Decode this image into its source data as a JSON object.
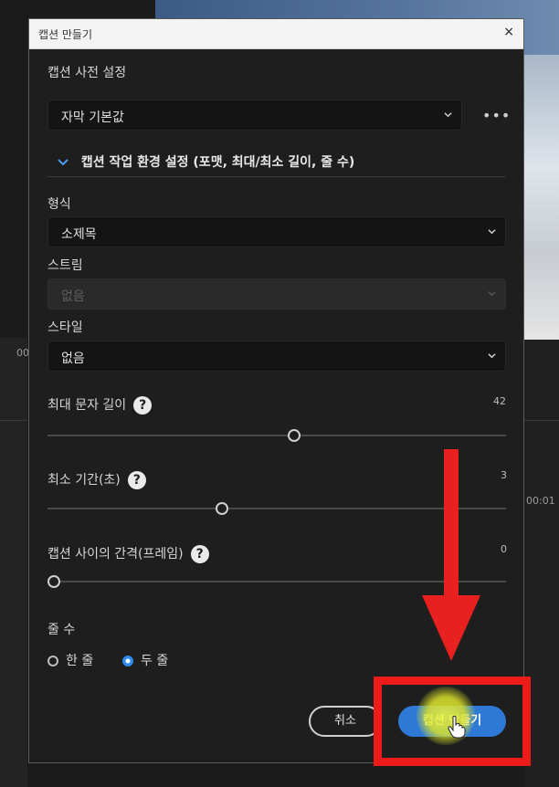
{
  "dialog": {
    "title": "캡션 만들기",
    "close_glyph": "×",
    "preset_label": "캡션 사전 설정",
    "preset_value": "자막 기본값",
    "more_glyph": "•••",
    "section_toggle_label": "캡션 작업 환경 설정 (포맷, 최대/최소 길이, 줄 수)",
    "format_label": "형식",
    "format_value": "소제목",
    "stream_label": "스트림",
    "stream_value": "없음",
    "style_label": "스타일",
    "style_value": "없음",
    "max_chars_label": "최대 문자 길이",
    "max_chars_value": "42",
    "min_duration_label": "최소 기간(초)",
    "min_duration_value": "3",
    "gap_label": "캡션 사이의 간격(프레임)",
    "gap_value": "0",
    "lines_label": "줄 수",
    "lines_options": [
      "한 줄",
      "두 줄"
    ],
    "lines_selected": "두 줄",
    "cancel_label": "취소",
    "create_label": "캡션 만들기",
    "help_glyph": "?"
  },
  "background": {
    "timecode_fragment": "00:01",
    "left_fragment": "00"
  },
  "colors": {
    "accent": "#2e79d6",
    "annotation_red": "#e8201f"
  }
}
